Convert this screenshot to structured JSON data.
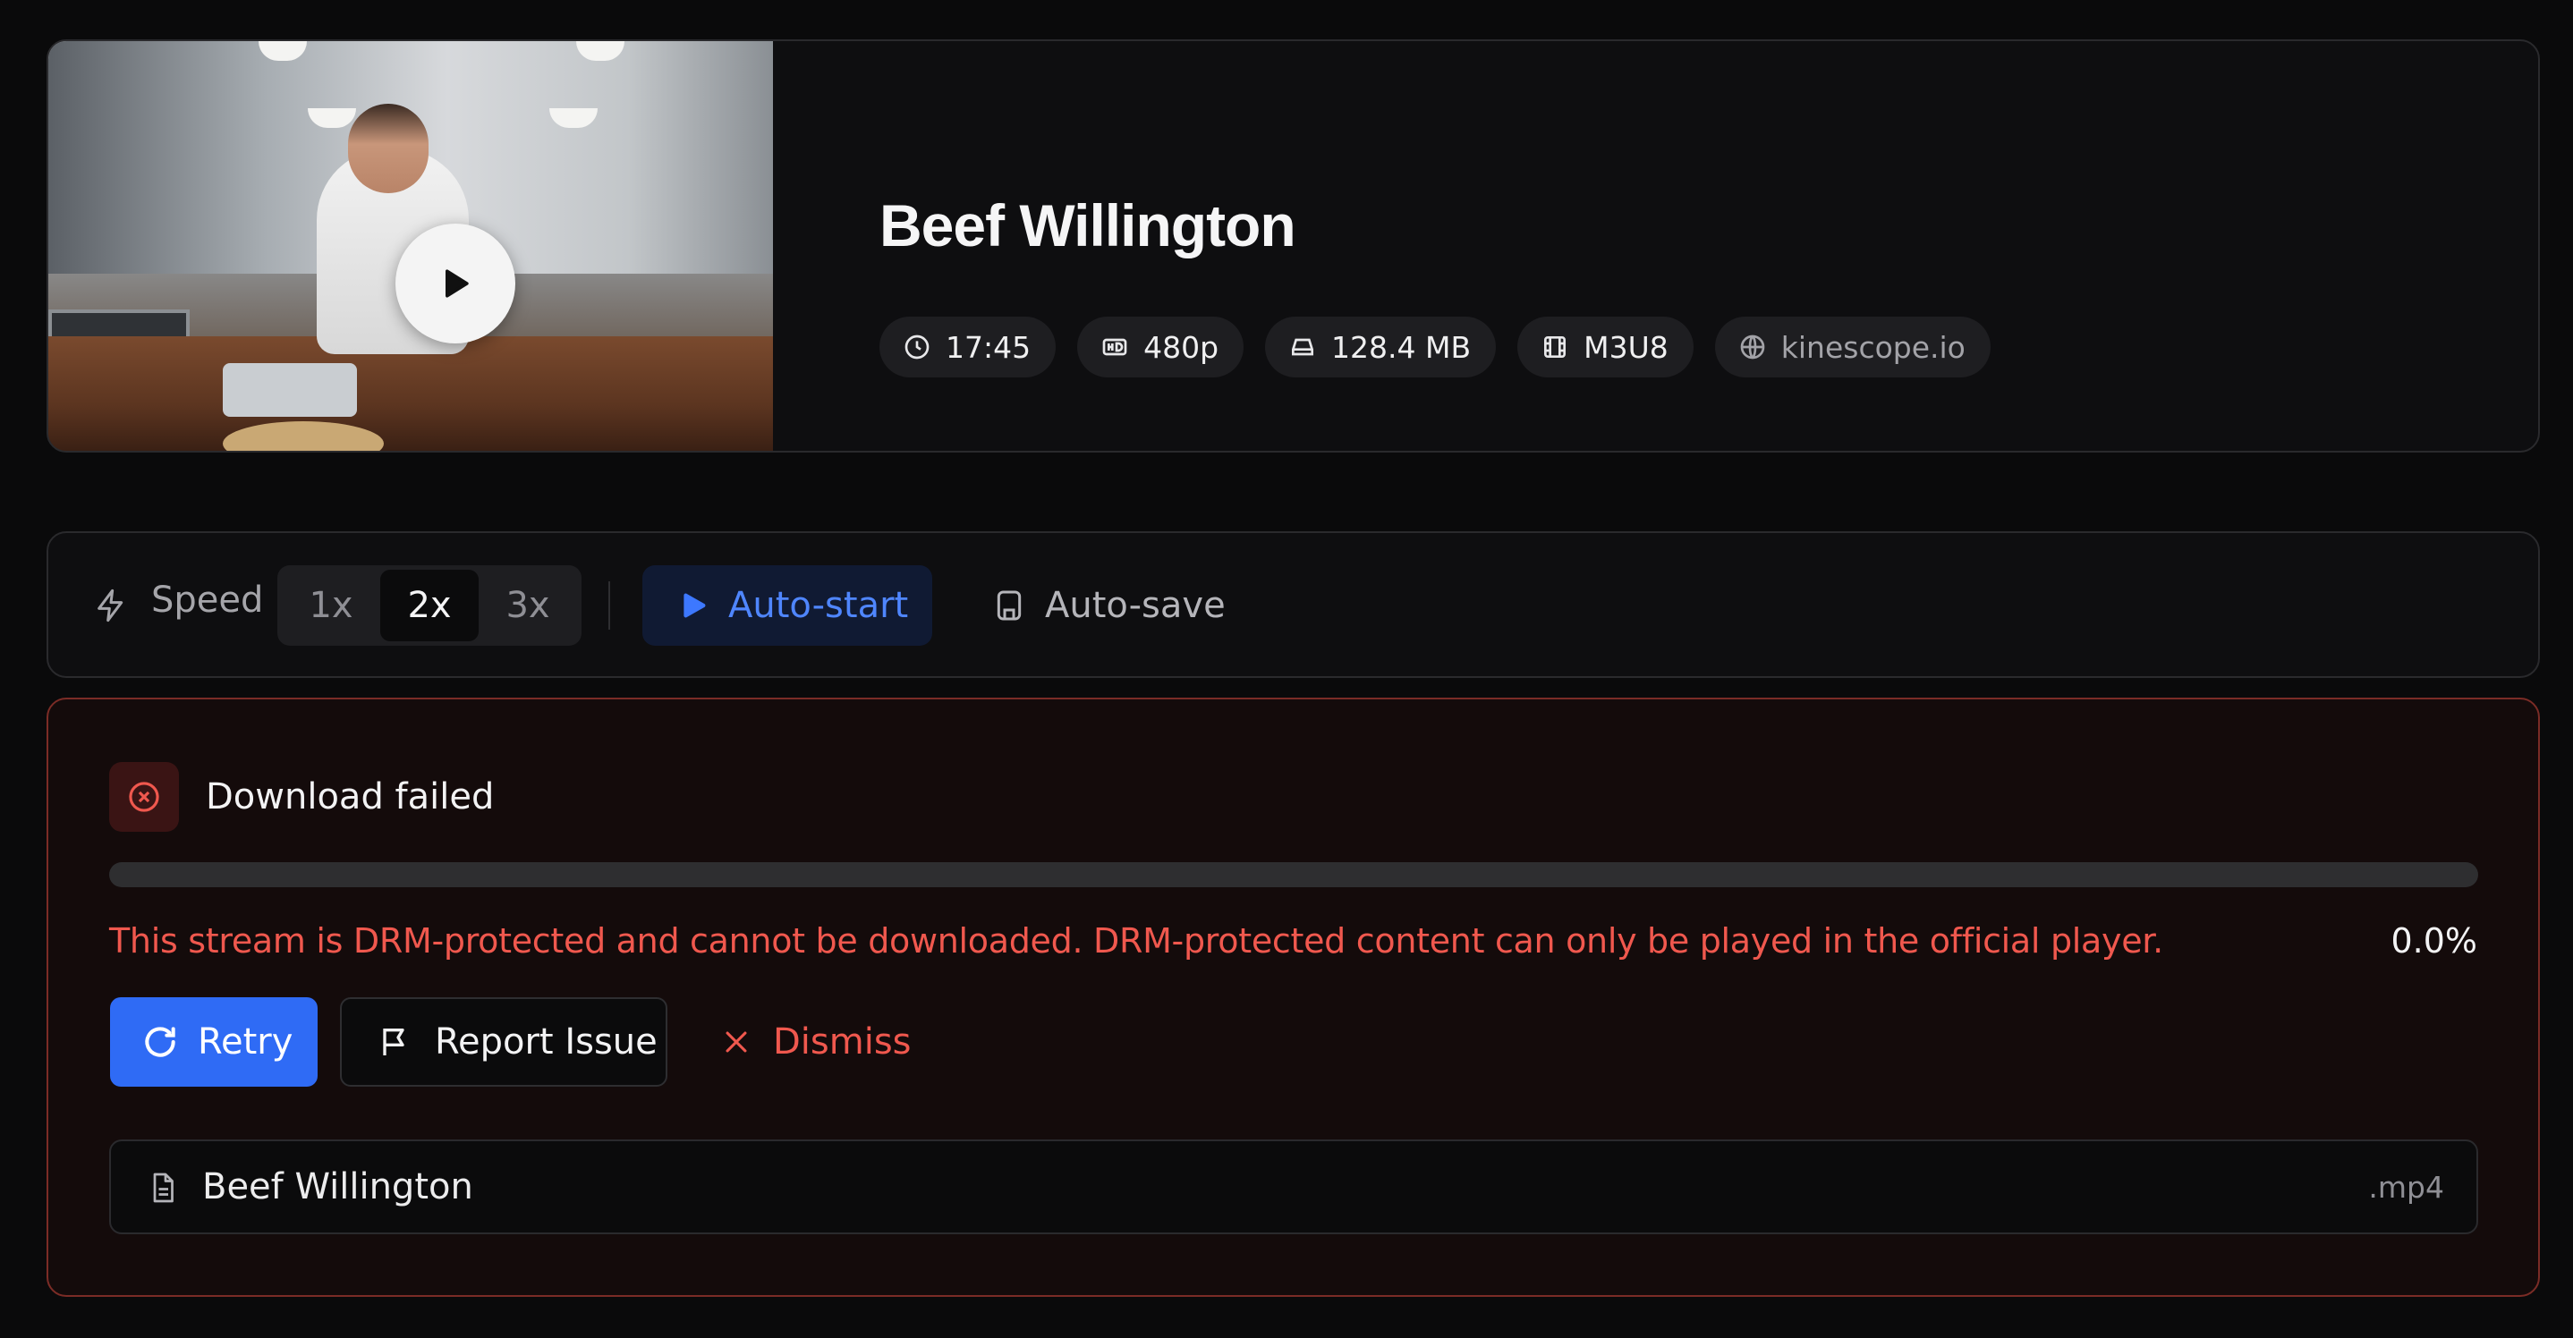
{
  "media": {
    "title": "Beef Willington",
    "thumbnail_icon": "play-icon",
    "chips": [
      {
        "icon": "clock-icon",
        "text": "17:45"
      },
      {
        "icon": "hd-icon",
        "text": "480p"
      },
      {
        "icon": "drive-icon",
        "text": "128.4 MB"
      },
      {
        "icon": "film-icon",
        "text": "M3U8"
      },
      {
        "icon": "globe-icon",
        "text": "kinescope.io"
      }
    ]
  },
  "settings": {
    "speed_label": "Speed",
    "speed_options": [
      "1x",
      "2x",
      "3x"
    ],
    "speed_selected": "2x",
    "autostart_label": "Auto-start",
    "autostart_on": true,
    "autosave_label": "Auto-save",
    "autosave_on": false
  },
  "error": {
    "title": "Download failed",
    "message": "This stream is DRM-protected and cannot be downloaded. DRM-protected content can only be played in the official player.",
    "progress_percent": 0.0,
    "percent_text": "0.0%",
    "retry_label": "Retry",
    "report_label": "Report Issue",
    "dismiss_label": "Dismiss",
    "file_name": "Beef Willington",
    "file_ext": ".mp4"
  },
  "colors": {
    "background": "#0a0a0b",
    "accent_blue": "#2f6bf5",
    "error_red": "#f0584e",
    "error_border": "#7b2c26"
  }
}
